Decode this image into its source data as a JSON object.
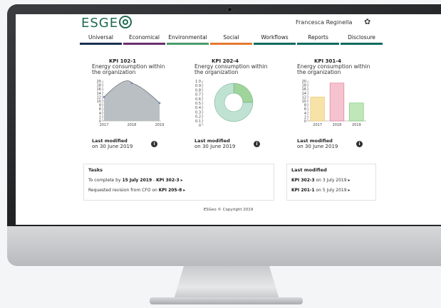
{
  "app": {
    "logo_text": "ESGE",
    "user_name": "Francesca Reginella",
    "settings_icon": "gear-icon",
    "brand_color": "#1f6b4f"
  },
  "nav": {
    "tabs": [
      {
        "label": "Universal",
        "color": "#1b2f50"
      },
      {
        "label": "Economical",
        "color": "#6b2d6e"
      },
      {
        "label": "Environmental",
        "color": "#4a9b6a"
      },
      {
        "label": "Social",
        "color": "#e57a2f"
      },
      {
        "label": "Workflows",
        "color": "#0f6b5f"
      },
      {
        "label": "Reports",
        "color": "#0f6b5f"
      },
      {
        "label": "Disclosure",
        "color": "#0f6b5f"
      }
    ]
  },
  "cards": [
    {
      "kpi": "KPI 102-1",
      "desc": "Energy consumption within the organization",
      "last_modified_label": "Last modified",
      "last_modified_date": "on 30 June 2019"
    },
    {
      "kpi": "KPI 202-4",
      "desc": "Energy consumption within the organization",
      "last_modified_label": "Last modified",
      "last_modified_date": "on 30 June 2019"
    },
    {
      "kpi": "KPI 301-4",
      "desc": "Energy consumption within the organization",
      "last_modified_label": "Last modified",
      "last_modified_date": "on 30 June 2019"
    }
  ],
  "chart_data": [
    {
      "type": "area",
      "x": [
        "2017",
        "2018",
        "2019"
      ],
      "values": [
        12,
        19,
        9
      ],
      "ylim": [
        0,
        20
      ],
      "yticks": [
        "0",
        "2",
        "4",
        "6",
        "8",
        "10",
        "12",
        "14",
        "16",
        "18",
        "20"
      ],
      "fill_color": "#b9bfc2",
      "line_color": "#6c7478"
    },
    {
      "type": "pie",
      "style": "donut",
      "values": [
        0.25,
        0.75
      ],
      "yticks": [
        "0",
        "0.1",
        "0.2",
        "0.3",
        "0.4",
        "0.5",
        "0.6",
        "0.7",
        "0.8",
        "0.9",
        "1.0"
      ],
      "colors": [
        "#9fd49a",
        "#bfe2d3"
      ]
    },
    {
      "type": "bar",
      "categories": [
        "2017",
        "2018",
        "2019"
      ],
      "values": [
        12,
        19,
        9
      ],
      "ylim": [
        0,
        20
      ],
      "yticks": [
        "0",
        "2",
        "4",
        "6",
        "8",
        "10",
        "12",
        "14",
        "16",
        "18",
        "20"
      ],
      "colors": [
        "#f7e3a8",
        "#f5c3cf",
        "#bfe7b8"
      ],
      "edge_colors": [
        "#e8c46a",
        "#e0708f",
        "#6cc465"
      ]
    }
  ],
  "tasks": {
    "title": "Tasks",
    "rows": [
      {
        "prefix": "To complete by ",
        "date": "15 July 2019",
        "sep": " - ",
        "kpi": "KPI 302-3",
        "arrow": "▸"
      },
      {
        "prefix": "Requested revision from CFO on ",
        "date": "",
        "sep": "",
        "kpi": "KPI 205-8",
        "arrow": "▸"
      }
    ]
  },
  "recent": {
    "title": "Last modified",
    "rows": [
      {
        "kpi": "KPI 302-3",
        "text": " on 3 July 2019 ",
        "arrow": "▸"
      },
      {
        "kpi": "KPI 201-1",
        "text": " on 5 July 2019 ",
        "arrow": "▸"
      }
    ]
  },
  "footer": "ESGeo © Copyright 2019"
}
